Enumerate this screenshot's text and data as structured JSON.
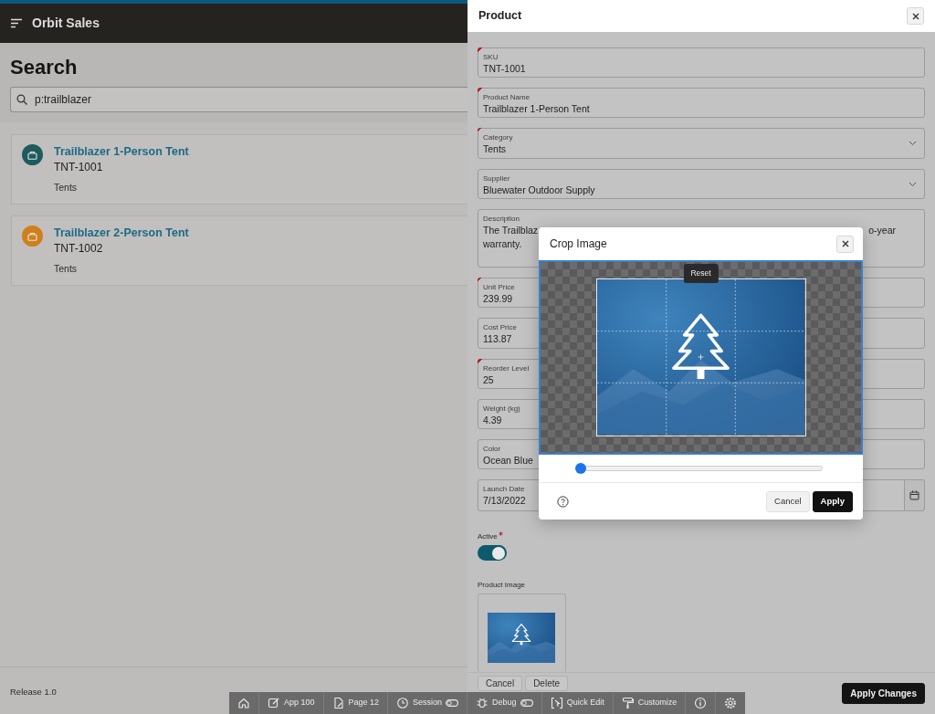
{
  "app": {
    "title": "Orbit Sales"
  },
  "search_page": {
    "heading": "Search",
    "search": {
      "value": "p:trailblazer"
    },
    "results": [
      {
        "title": "Trailblazer 1-Person Tent",
        "sku": "TNT-1001",
        "category": "Tents",
        "color": "#1f5a5c"
      },
      {
        "title": "Trailblazer 2-Person Tent",
        "sku": "TNT-1002",
        "category": "Tents",
        "color": "#d07f1a"
      }
    ]
  },
  "footer": {
    "release": "Release 1.0"
  },
  "drawer": {
    "title": "Product",
    "fields": [
      {
        "kind": "text",
        "label": "SKU",
        "value": "TNT-1001",
        "required": true
      },
      {
        "kind": "text",
        "label": "Product Name",
        "value": "Trailblazer 1-Person Tent",
        "required": true
      },
      {
        "kind": "select",
        "label": "Category",
        "value": "Tents",
        "required": true
      },
      {
        "kind": "select",
        "label": "Supplier",
        "value": "Bluewater Outdoor Supply",
        "required": false
      },
      {
        "kind": "textarea",
        "label": "Description",
        "lines": [
          [
            "The Trailblaz",
            "o-year"
          ],
          [
            "warranty."
          ]
        ],
        "required": false
      },
      {
        "kind": "text",
        "label": "Unit Price",
        "value": "239.99",
        "required": true
      },
      {
        "kind": "text",
        "label": "Cost Price",
        "value": "113.87",
        "required": false
      },
      {
        "kind": "text",
        "label": "Reorder Level",
        "value": "25",
        "required": true
      },
      {
        "kind": "text",
        "label": "Weight (kg)",
        "value": "4.39",
        "required": false
      },
      {
        "kind": "text",
        "label": "Color",
        "value": "Ocean Blue",
        "required": false
      },
      {
        "kind": "date",
        "label": "Launch Date",
        "value": "7/13/2022",
        "required": false
      }
    ],
    "active": {
      "label": "Active",
      "required": true,
      "on": true
    },
    "image": {
      "label": "Product Image",
      "kind": "picture"
    },
    "buttons": [
      {
        "label": "Cancel",
        "kind": "secondary"
      },
      {
        "label": "Delete",
        "kind": "secondary"
      },
      {
        "label": "Apply Changes",
        "kind": "primary"
      }
    ]
  },
  "crop_dialog": {
    "title": "Crop Image",
    "reset": "Reset",
    "zoom": {
      "level": 0
    },
    "buttons": [
      {
        "label": "Cancel",
        "kind": "secondary"
      },
      {
        "label": "Apply",
        "kind": "primary"
      }
    ]
  },
  "dev_toolbar": [
    {
      "toggle": false
    },
    {
      "label": "App 100",
      "toggle": false
    },
    {
      "label": "Page 12",
      "toggle": false
    },
    {
      "label": "Session",
      "toggle": true
    },
    {
      "label": "Debug",
      "toggle": true
    },
    {
      "label": "Quick Edit",
      "toggle": false
    },
    {
      "label": "Customize",
      "toggle": false
    },
    {
      "toggle": false
    },
    {
      "toggle": false
    }
  ]
}
